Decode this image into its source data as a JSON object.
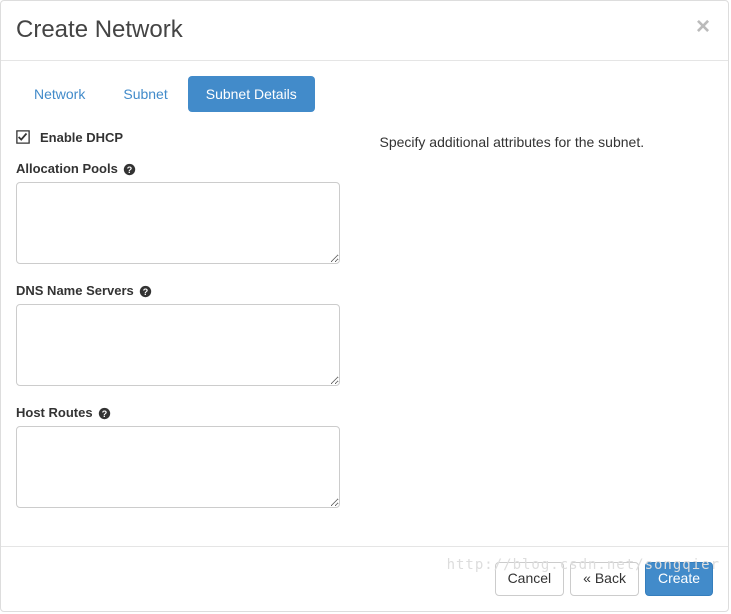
{
  "header": {
    "title": "Create Network",
    "close_glyph": "×"
  },
  "tabs": {
    "network": "Network",
    "subnet": "Subnet",
    "subnet_details": "Subnet Details"
  },
  "form": {
    "enable_dhcp_label": "Enable DHCP",
    "enable_dhcp_checked": true,
    "allocation_pools_label": "Allocation Pools",
    "allocation_pools_value": "",
    "dns_name_servers_label": "DNS Name Servers",
    "dns_name_servers_value": "",
    "host_routes_label": "Host Routes",
    "host_routes_value": ""
  },
  "description": "Specify additional attributes for the subnet.",
  "footer": {
    "cancel_label": "Cancel",
    "back_label": "« Back",
    "create_label": "Create"
  },
  "watermark": "http://blog.csdn.net/songqier"
}
